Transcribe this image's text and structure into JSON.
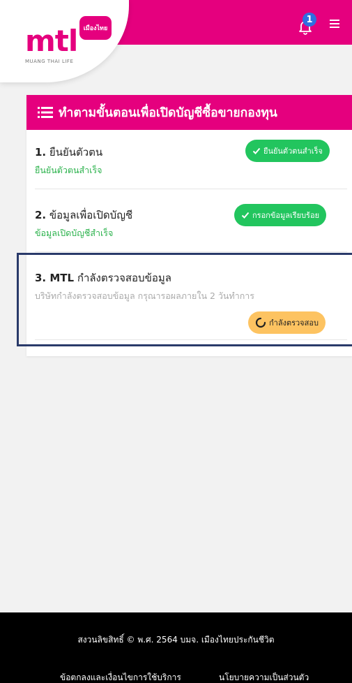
{
  "header": {
    "logo_text": "mtl",
    "logo_badge_text": "เมืองไทย",
    "logo_subtitle": "MUANG THAI LIFE",
    "notification_count": "1",
    "brand_color": "#e5007e"
  },
  "card": {
    "title": "ทำตามขั้นตอนเพื่อเปิดบัญชีซื้อขายกองทุน",
    "steps": [
      {
        "number": "1.",
        "title": "ยืนยันตัวตน",
        "subtitle": "ยืนยันตัวตนสำเร็จ",
        "status": "ยืนยันตัวตนสำเร็จ",
        "status_color": "#22c55e",
        "status_icon": "check-icon"
      },
      {
        "number": "2.",
        "title": "ข้อมูลเพื่อเปิดบัญชี",
        "subtitle": "ข้อมูลเปิดบัญชีสำเร็จ",
        "status": "กรอกข้อมูลเรียบร้อย",
        "status_color": "#22c55e",
        "status_icon": "check-icon"
      },
      {
        "number": "3. MTL",
        "title": "กำลังตรวจสอบข้อมูล",
        "subtitle": "บริษัทกำลังตรวจสอบข้อมูล กรุณารอผลภายใน 2 วันทำการ",
        "status": "กำลังตรวจสอบ",
        "status_color": "#fdc361",
        "status_icon": "spinner-icon"
      }
    ]
  },
  "footer": {
    "copyright": "สงวนลิขสิทธิ์ © พ.ศ. 2564 บมจ. เมืองไทยประกันชีวิต",
    "terms_link": "ข้อตกลงและเงื่อนไขการใช้บริการ",
    "privacy_link": "นโยบายความเป็นส่วนตัว"
  }
}
